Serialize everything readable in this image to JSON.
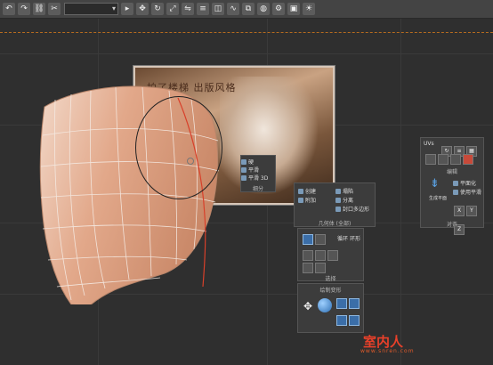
{
  "toolbar": {
    "dropdown_value": "",
    "icons": [
      "undo-icon",
      "redo-icon",
      "link-icon",
      "unlink-icon",
      "select-icon",
      "move-icon",
      "rotate-icon",
      "scale-icon",
      "mirror-icon",
      "align-icon",
      "layer-icon",
      "curve-editor-icon",
      "schematic-icon",
      "material-icon",
      "render-setup-icon",
      "render-frame-icon",
      "render-icon"
    ]
  },
  "photo_text": "拍了楼梯 出版风格",
  "context_menu": {
    "items": [
      "硬",
      "平滑",
      "平滑 3D"
    ],
    "title": "细分"
  },
  "geometry_panel": {
    "items": [
      "创建",
      "附加",
      "塌陷",
      "分离",
      "封口多边形"
    ],
    "title": "几何体 (全部)"
  },
  "selection_panel": {
    "labels": [
      "循环",
      "环形"
    ],
    "title": "选择"
  },
  "deform_panel": {
    "title": "绘制变形"
  },
  "right_panel": {
    "label_uvw": "UVs",
    "actions": [
      "生成平面",
      "平面化",
      "对齐",
      "使用平滑",
      "按边缘"
    ],
    "title_top": "编辑",
    "title_bottom": "对齐"
  },
  "watermark": {
    "main": "室内人",
    "sub": "www.snren.com"
  }
}
